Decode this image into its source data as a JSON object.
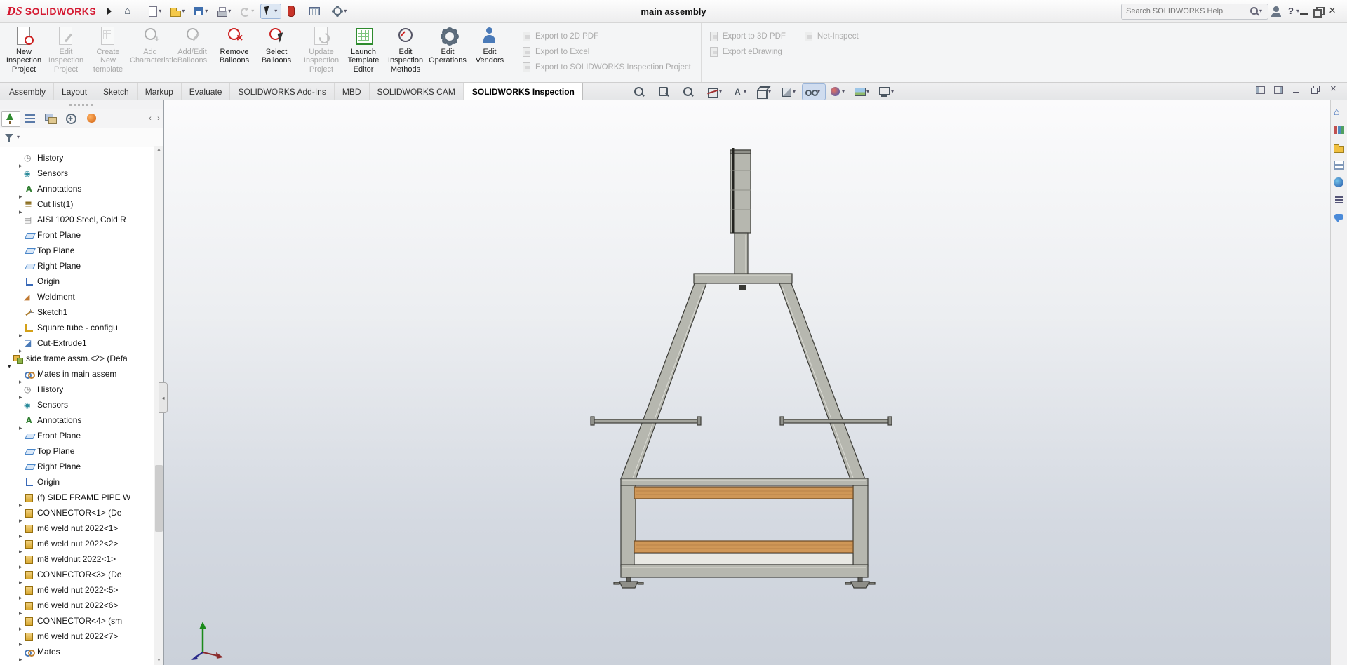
{
  "colors": {
    "brand_red": "#d41931",
    "steel_gray": "#b6b7af",
    "wood_orange": "#cf9757",
    "disabled_text": "#ababab",
    "viewport_gradient_top": "#fbfbfc",
    "viewport_gradient_bottom": "#cbd1da",
    "triad_y_green": "#1a8a1a"
  },
  "titlebar": {
    "logo_prefix": "DS",
    "app_name": "SOLIDWORKS",
    "document_title": "main  assembly",
    "search_placeholder": "Search SOLIDWORKS Help",
    "quick_access": [
      {
        "name": "home-button",
        "icon": "home",
        "caret": false
      },
      {
        "name": "new-document-button",
        "icon": "new-doc",
        "caret": true
      },
      {
        "name": "open-button",
        "icon": "open",
        "caret": true
      },
      {
        "name": "save-button",
        "icon": "save",
        "caret": true
      },
      {
        "name": "print-button",
        "icon": "print",
        "caret": true
      },
      {
        "name": "undo-button",
        "icon": "undo",
        "caret": true,
        "disabled": true
      },
      {
        "name": "select-button",
        "icon": "select",
        "caret": true,
        "pressed": true
      },
      {
        "name": "rebuild-button",
        "icon": "rebuild",
        "caret": false
      },
      {
        "name": "file-properties-button",
        "icon": "sheet",
        "caret": false
      },
      {
        "name": "options-button",
        "icon": "options",
        "caret": true
      }
    ],
    "window_controls": [
      {
        "name": "user-account-button",
        "icon": "user",
        "caret": false
      },
      {
        "name": "help-button",
        "icon": "help",
        "caret": true
      },
      {
        "name": "minimize-window-button",
        "icon": "minimize",
        "caret": false
      },
      {
        "name": "restore-window-button",
        "icon": "restore",
        "caret": false
      },
      {
        "name": "close-window-button",
        "icon": "close",
        "caret": false
      }
    ]
  },
  "ribbon": {
    "buttons": [
      {
        "name": "new-inspection-project-button",
        "icon": "new-project",
        "label": "New Inspection Project",
        "enabled": true
      },
      {
        "name": "edit-inspection-project-button",
        "icon": "edit-project",
        "label": "Edit Inspection Project",
        "enabled": false
      },
      {
        "name": "create-new-template-button",
        "icon": "new-template",
        "label": "Create New template",
        "enabled": false
      },
      {
        "name": "add-characteristic-button",
        "icon": "add-characteristic",
        "label": "Add Characteristic",
        "enabled": false
      },
      {
        "name": "add-edit-balloons-button",
        "icon": "add-edit-balloons",
        "label": "Add/Edit Balloons",
        "enabled": false
      },
      {
        "name": "remove-balloons-button",
        "icon": "remove-balloons",
        "label": "Remove Balloons",
        "enabled": true
      },
      {
        "name": "select-balloons-button",
        "icon": "select-balloons",
        "label": "Select Balloons",
        "enabled": true
      },
      {
        "name": "update-inspection-project-button",
        "icon": "update-project",
        "label": "Update Inspection Project",
        "enabled": false,
        "sep": true
      },
      {
        "name": "launch-template-editor-button",
        "icon": "template-editor",
        "label": "Launch Template Editor",
        "enabled": true
      },
      {
        "name": "edit-inspection-methods-button",
        "icon": "inspection-methods",
        "label": "Edit Inspection Methods",
        "enabled": true
      },
      {
        "name": "edit-operations-button",
        "icon": "operations",
        "label": "Edit Operations",
        "enabled": true
      },
      {
        "name": "edit-vendors-button",
        "icon": "vendors",
        "label": "Edit Vendors",
        "enabled": true
      }
    ],
    "export_col1": [
      {
        "name": "export-to-2d-pdf-button",
        "icon": "pdf",
        "label": "Export to 2D PDF",
        "enabled": false
      },
      {
        "name": "export-to-excel-button",
        "icon": "excel",
        "label": "Export to Excel",
        "enabled": false
      },
      {
        "name": "export-to-sw-inspection-project-button",
        "icon": "swproj",
        "label": "Export to SOLIDWORKS Inspection Project",
        "enabled": false
      }
    ],
    "export_col2": [
      {
        "name": "export-to-3d-pdf-button",
        "icon": "pdf",
        "label": "Export to 3D PDF",
        "enabled": false
      },
      {
        "name": "export-edrawing-button",
        "icon": "edrw",
        "label": "Export eDrawing",
        "enabled": false
      }
    ],
    "export_col3": [
      {
        "name": "net-inspect-button",
        "icon": "net",
        "label": "Net-Inspect",
        "enabled": false
      }
    ]
  },
  "command_tabs": [
    {
      "name": "tab-assembly",
      "label": "Assembly",
      "active": false
    },
    {
      "name": "tab-layout",
      "label": "Layout",
      "active": false
    },
    {
      "name": "tab-sketch",
      "label": "Sketch",
      "active": false
    },
    {
      "name": "tab-markup",
      "label": "Markup",
      "active": false
    },
    {
      "name": "tab-evaluate",
      "label": "Evaluate",
      "active": false
    },
    {
      "name": "tab-solidworks-add-ins",
      "label": "SOLIDWORKS Add-Ins",
      "active": false
    },
    {
      "name": "tab-mbd",
      "label": "MBD",
      "active": false
    },
    {
      "name": "tab-solidworks-cam",
      "label": "SOLIDWORKS CAM",
      "active": false
    },
    {
      "name": "tab-solidworks-inspection",
      "label": "SOLIDWORKS Inspection",
      "active": true
    }
  ],
  "hud_toolbar": [
    {
      "name": "zoom-to-fit-icon",
      "icon": "zoom-fit",
      "caret": false
    },
    {
      "name": "zoom-to-area-icon",
      "icon": "zoom-area",
      "caret": false
    },
    {
      "name": "previous-view-icon",
      "icon": "previous-view",
      "caret": false
    },
    {
      "name": "section-view-icon",
      "icon": "section-view",
      "caret": true
    },
    {
      "name": "annotation-views-icon",
      "icon": "annotation-views",
      "caret": true
    },
    {
      "name": "view-orientation-icon",
      "icon": "view-orientation",
      "caret": true
    },
    {
      "name": "display-style-icon",
      "icon": "display-style",
      "caret": true
    },
    {
      "name": "hide-show-items-icon",
      "icon": "hide-show",
      "caret": true,
      "pressed": true
    },
    {
      "name": "edit-appearance-icon",
      "icon": "appearance",
      "caret": true
    },
    {
      "name": "apply-scene-icon",
      "icon": "scene",
      "caret": true
    },
    {
      "name": "view-settings-icon",
      "icon": "view-settings",
      "caret": true
    }
  ],
  "doc_controls": [
    {
      "name": "dock-pane-left-button",
      "icon": "dockl"
    },
    {
      "name": "dock-pane-right-button",
      "icon": "dockr"
    },
    {
      "name": "minimize-document-button",
      "icon": "minimize"
    },
    {
      "name": "restore-document-button",
      "icon": "restore"
    },
    {
      "name": "close-document-button",
      "icon": "close"
    }
  ],
  "feature_panel": {
    "scroll_left": "‹",
    "scroll_right": "›",
    "tabs": [
      {
        "name": "featuremanager-tab",
        "icon": "featuremanager",
        "active": true
      },
      {
        "name": "propertymanager-tab",
        "icon": "propertymanager",
        "active": false
      },
      {
        "name": "configurationmanager-tab",
        "icon": "configurationmanager",
        "active": false
      },
      {
        "name": "dimxpertmanager-tab",
        "icon": "dimxpertmanager",
        "active": false
      },
      {
        "name": "displaymanager-tab",
        "icon": "displaymanager",
        "active": false
      }
    ],
    "tree": [
      {
        "indent": 1,
        "arrow": "right",
        "icon": "history",
        "label": "History"
      },
      {
        "indent": 1,
        "arrow": "none",
        "icon": "sensors",
        "label": "Sensors"
      },
      {
        "indent": 1,
        "arrow": "right",
        "icon": "annotations",
        "label": "Annotations"
      },
      {
        "indent": 1,
        "arrow": "right",
        "icon": "cutlist",
        "label": "Cut list(1)"
      },
      {
        "indent": 1,
        "arrow": "none",
        "icon": "material",
        "label": "AISI 1020 Steel, Cold R"
      },
      {
        "indent": 1,
        "arrow": "none",
        "icon": "plane",
        "label": "Front Plane"
      },
      {
        "indent": 1,
        "arrow": "none",
        "icon": "plane",
        "label": "Top Plane"
      },
      {
        "indent": 1,
        "arrow": "none",
        "icon": "plane",
        "label": "Right Plane"
      },
      {
        "indent": 1,
        "arrow": "none",
        "icon": "origin",
        "label": "Origin"
      },
      {
        "indent": 1,
        "arrow": "none",
        "icon": "weldment",
        "label": "Weldment"
      },
      {
        "indent": 1,
        "arrow": "none",
        "icon": "sketch",
        "label": "Sketch1"
      },
      {
        "indent": 1,
        "arrow": "right",
        "icon": "profile",
        "label": "Square tube - configu"
      },
      {
        "indent": 1,
        "arrow": "right",
        "icon": "cutextrude",
        "label": "Cut-Extrude1"
      },
      {
        "indent": 0,
        "arrow": "down",
        "icon": "assembly",
        "label": "side frame assm.<2> (Defa"
      },
      {
        "indent": 1,
        "arrow": "right",
        "icon": "matesfolder",
        "label": "Mates in main  assem"
      },
      {
        "indent": 1,
        "arrow": "right",
        "icon": "history",
        "label": "History"
      },
      {
        "indent": 1,
        "arrow": "none",
        "icon": "sensors",
        "label": "Sensors"
      },
      {
        "indent": 1,
        "arrow": "right",
        "icon": "annotations",
        "label": "Annotations"
      },
      {
        "indent": 1,
        "arrow": "none",
        "icon": "plane",
        "label": "Front Plane"
      },
      {
        "indent": 1,
        "arrow": "none",
        "icon": "plane",
        "label": "Top Plane"
      },
      {
        "indent": 1,
        "arrow": "none",
        "icon": "plane",
        "label": "Right Plane"
      },
      {
        "indent": 1,
        "arrow": "none",
        "icon": "origin",
        "label": "Origin"
      },
      {
        "indent": 1,
        "arrow": "right",
        "icon": "part",
        "label": "(f) SIDE FRAME PIPE W"
      },
      {
        "indent": 1,
        "arrow": "right",
        "icon": "part",
        "label": "CONNECTOR<1> (De"
      },
      {
        "indent": 1,
        "arrow": "right",
        "icon": "part",
        "label": "m6 weld nut 2022<1>"
      },
      {
        "indent": 1,
        "arrow": "right",
        "icon": "part",
        "label": "m6 weld nut 2022<2>"
      },
      {
        "indent": 1,
        "arrow": "right",
        "icon": "part",
        "label": "m8 weldnut 2022<1>"
      },
      {
        "indent": 1,
        "arrow": "right",
        "icon": "part",
        "label": "CONNECTOR<3> (De"
      },
      {
        "indent": 1,
        "arrow": "right",
        "icon": "part",
        "label": "m6 weld nut 2022<5>"
      },
      {
        "indent": 1,
        "arrow": "right",
        "icon": "part",
        "label": "m6 weld nut 2022<6>"
      },
      {
        "indent": 1,
        "arrow": "right",
        "icon": "part",
        "label": "CONNECTOR<4> (sm"
      },
      {
        "indent": 1,
        "arrow": "right",
        "icon": "part",
        "label": "m6 weld nut 2022<7>"
      },
      {
        "indent": 1,
        "arrow": "right",
        "icon": "matesfolder",
        "label": "Mates"
      }
    ]
  },
  "task_pane": [
    {
      "name": "solidworks-resources-icon",
      "icon": "resources"
    },
    {
      "name": "design-library-icon",
      "icon": "design-library"
    },
    {
      "name": "file-explorer-icon",
      "icon": "file-explorer"
    },
    {
      "name": "view-palette-icon",
      "icon": "view-palette"
    },
    {
      "name": "appearances-scenes-icon",
      "icon": "appearances"
    },
    {
      "name": "custom-properties-icon",
      "icon": "custom-properties"
    },
    {
      "name": "solidworks-forum-icon",
      "icon": "forum"
    }
  ]
}
